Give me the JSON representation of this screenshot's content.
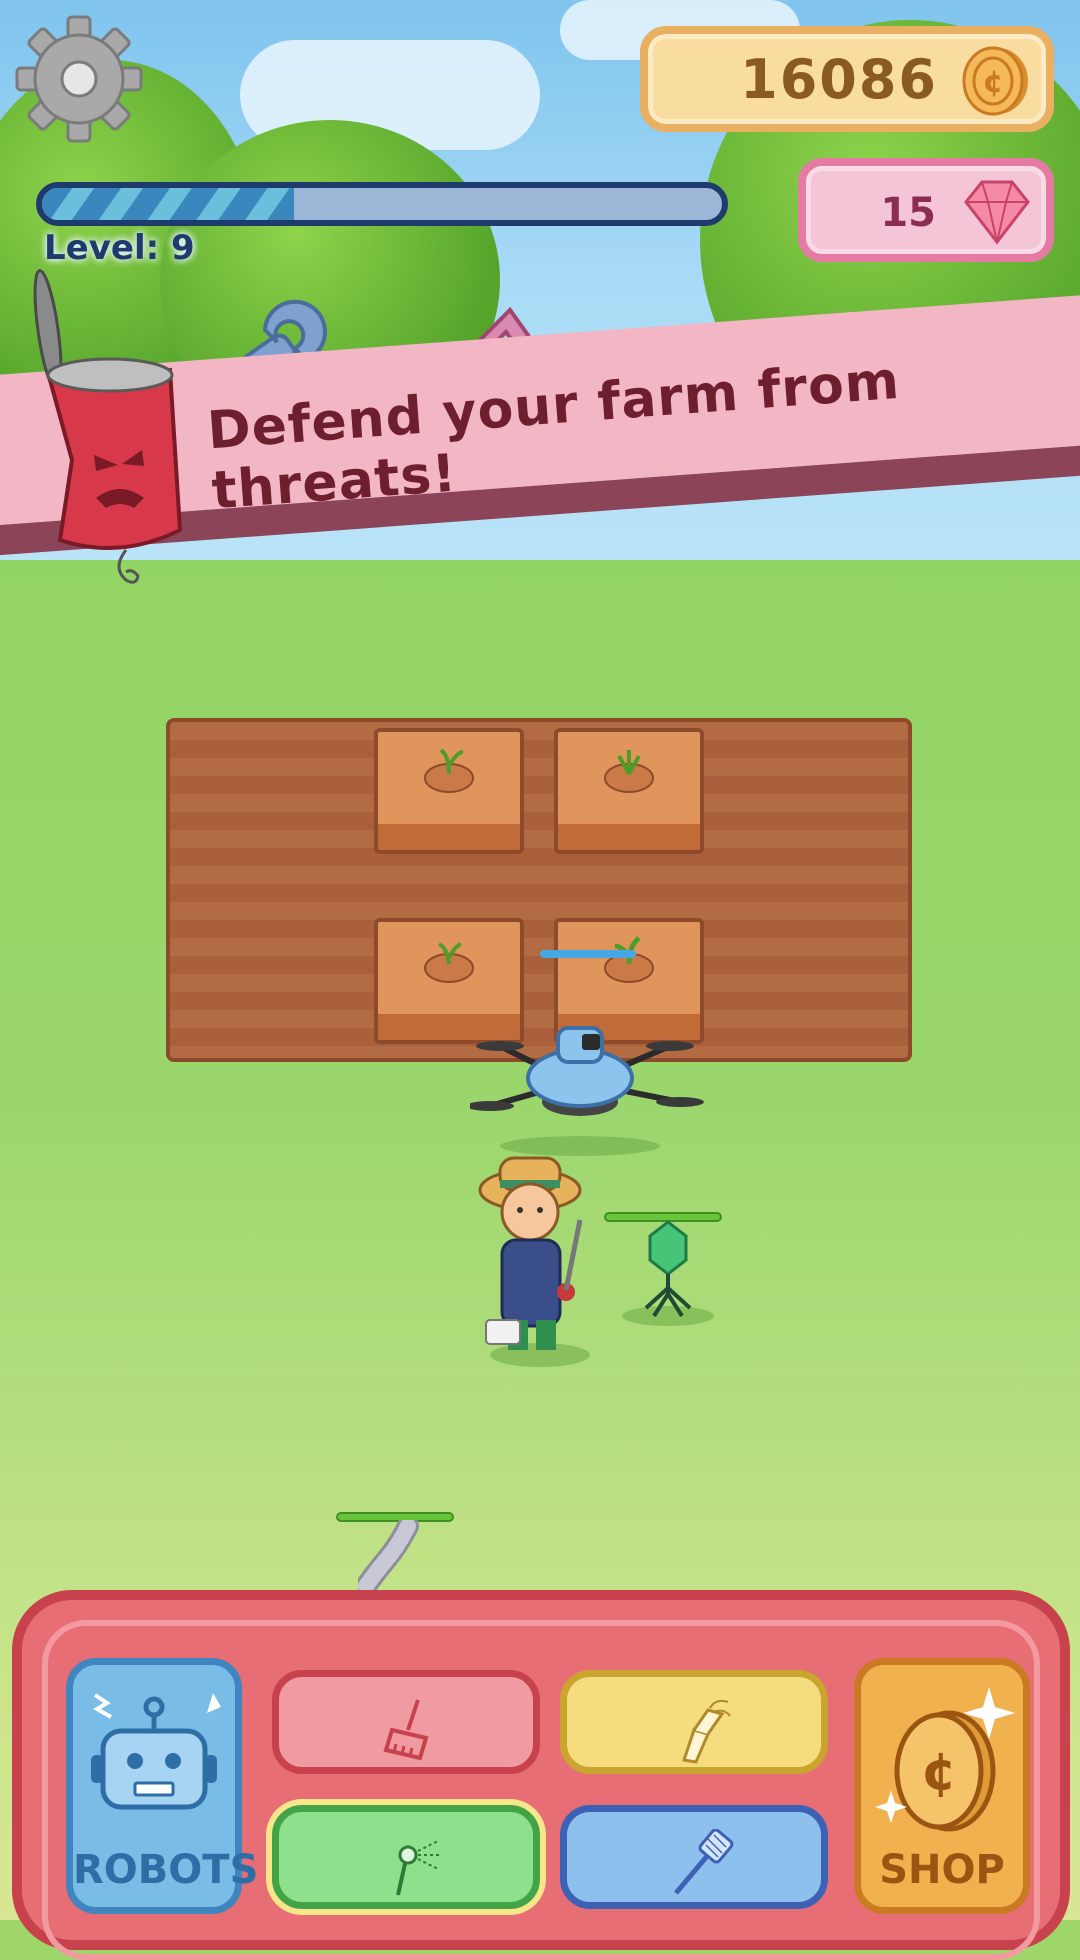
{
  "hud": {
    "coins": "16086",
    "gems": "15",
    "level_label": "Level: 9",
    "xp_progress_percent": 37
  },
  "banner": {
    "text": "Defend your farm from threats!"
  },
  "tray": {
    "robots_label": "ROBOTS",
    "shop_label": "SHOP",
    "tools": [
      "broom",
      "flashlight",
      "sprayer",
      "fly-swatter"
    ],
    "selected_tool": "sprayer"
  },
  "colors": {
    "coin_panel": "#f8dca0",
    "gem_panel": "#f3c5d6",
    "banner": "#f3b6c4",
    "banner_text": "#6e1f2d",
    "tray": "#e86e75"
  }
}
